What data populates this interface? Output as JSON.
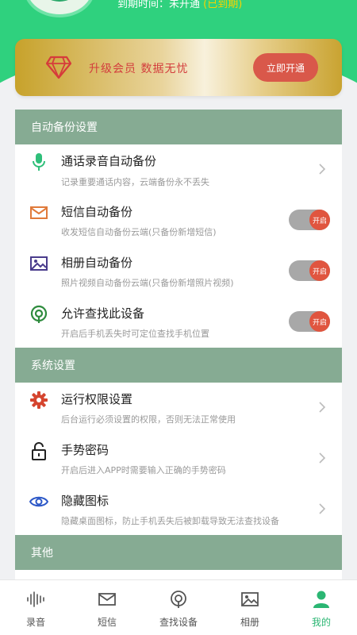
{
  "header": {
    "expire_label": "到期时间：未开通",
    "expire_status": "(已到期)"
  },
  "vip": {
    "text": "升级会员 数据无忧",
    "button": "立即开通",
    "diamond_icon": "diamond-icon"
  },
  "sections": [
    {
      "title": "自动备份设置"
    },
    {
      "title": "系统设置"
    },
    {
      "title": "其他"
    }
  ],
  "backup": [
    {
      "title": "通话录音自动备份",
      "desc": "记录重要通话内容，云端备份永不丢失",
      "icon": "microphone-icon",
      "control": "chevron"
    },
    {
      "title": "短信自动备份",
      "desc": "收发短信自动备份云端(只备份新增短信)",
      "icon": "envelope-icon",
      "control": "toggle",
      "toggle_label": "开启"
    },
    {
      "title": "相册自动备份",
      "desc": "照片视频自动备份云端(只备份新增照片视频)",
      "icon": "image-icon",
      "control": "toggle",
      "toggle_label": "开启"
    },
    {
      "title": "允许查找此设备",
      "desc": "开启后手机丢失时可定位查找手机位置",
      "icon": "locate-icon",
      "control": "toggle",
      "toggle_label": "开启"
    }
  ],
  "system": [
    {
      "title": "运行权限设置",
      "desc": "后台运行必须设置的权限，否则无法正常使用",
      "icon": "gear-icon"
    },
    {
      "title": "手势密码",
      "desc": "开启后进入APP时需要输入正确的手势密码",
      "icon": "lock-icon"
    },
    {
      "title": "隐藏图标",
      "desc": "隐藏桌面图标，防止手机丢失后被卸载导致无法查找设备",
      "icon": "eye-icon"
    }
  ],
  "tabs": [
    {
      "label": "录音",
      "icon": "waveform-icon"
    },
    {
      "label": "短信",
      "icon": "envelope-icon"
    },
    {
      "label": "查找设备",
      "icon": "locate-icon"
    },
    {
      "label": "相册",
      "icon": "image-icon"
    },
    {
      "label": "我的",
      "icon": "person-icon",
      "active": true
    }
  ],
  "colors": {
    "brand_green": "#2fd17e",
    "section_header": "#86ab93",
    "toggle_on": "#e0553f",
    "vip_button": "#d9584a",
    "active_tab": "#2bb673"
  }
}
